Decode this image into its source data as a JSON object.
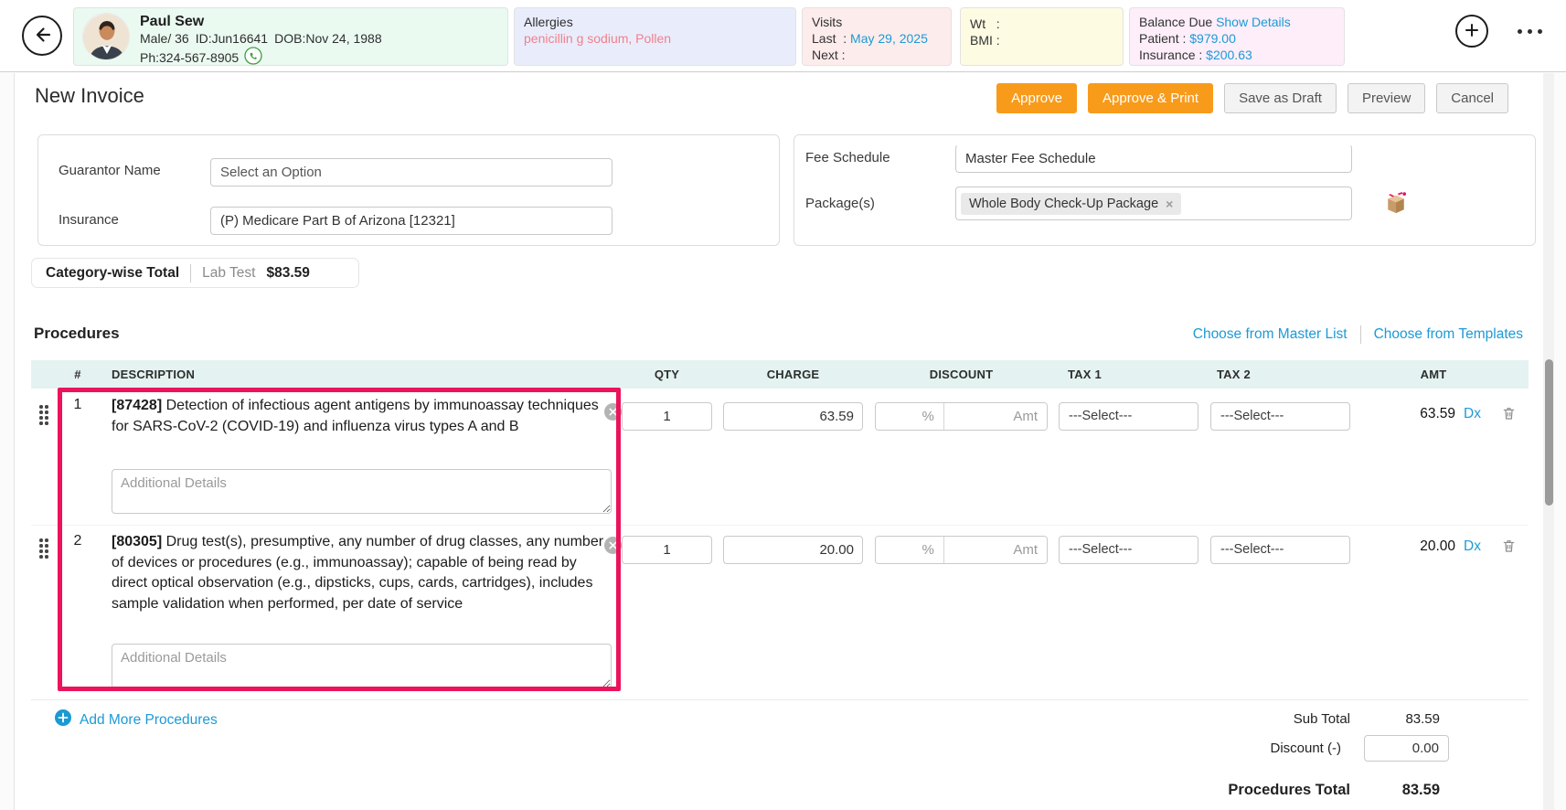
{
  "header": {
    "patient": {
      "name": "Paul Sew",
      "sex_age": "Male/ 36",
      "id": "ID:Jun16641",
      "dob": "DOB:Nov 24, 1988",
      "phone": "Ph:324-567-8905"
    },
    "allergies": {
      "title": "Allergies",
      "value": "penicillin g sodium, Pollen"
    },
    "visits": {
      "title": "Visits",
      "last_label": "Last  :",
      "last_value": "May 29, 2025",
      "next_label": "Next :"
    },
    "vitals": {
      "wt_label": "Wt   :",
      "bmi_label": "BMI :"
    },
    "balance": {
      "title": "Balance Due",
      "show_details": "Show Details",
      "patient_label": "Patient :",
      "patient_value": "$979.00",
      "insurance_label": "Insurance :",
      "insurance_value": "$200.63"
    }
  },
  "toolbar": {
    "title": "New Invoice",
    "approve": "Approve",
    "approve_print": "Approve & Print",
    "save_draft": "Save as Draft",
    "preview": "Preview",
    "cancel": "Cancel"
  },
  "form": {
    "guarantor_label": "Guarantor Name",
    "guarantor_placeholder": "Select an Option",
    "insurance_label": "Insurance",
    "insurance_value": "(P) Medicare Part B of Arizona [12321]",
    "fee_schedule_label": "Fee Schedule",
    "fee_schedule_value": "Master Fee Schedule",
    "packages_label": "Package(s)",
    "package_chip": "Whole Body Check-Up Package",
    "chip_remove": "×"
  },
  "category_total": {
    "label": "Category-wise Total",
    "category": "Lab Test",
    "amount": "$83.59"
  },
  "procedures": {
    "title": "Procedures",
    "choose_master": "Choose from Master List",
    "choose_templates": "Choose from Templates",
    "columns": [
      "#",
      "DESCRIPTION",
      "QTY",
      "CHARGE",
      "DISCOUNT",
      "TAX 1",
      "TAX 2",
      "AMT"
    ],
    "discount_pct_placeholder": "%",
    "discount_amt_placeholder": "Amt",
    "tax_placeholder": "---Select---",
    "additional_details_placeholder": "Additional Details",
    "dx_label": "Dx",
    "rows": [
      {
        "num": "1",
        "code": "[87428]",
        "description": "Detection of infectious agent antigens by immunoassay techniques for SARS-CoV-2 (COVID-19) and influenza virus types A and B",
        "qty": "1",
        "charge": "63.59",
        "amt": "63.59"
      },
      {
        "num": "2",
        "code": "[80305]",
        "description": "Drug test(s), presumptive, any number of drug classes, any number of devices or procedures (e.g., immunoassay); capable of being read by direct optical observation (e.g., dipsticks, cups, cards, cartridges), includes sample validation when performed, per date of service",
        "qty": "1",
        "charge": "20.00",
        "amt": "20.00"
      }
    ],
    "add_more": "Add More Procedures"
  },
  "totals": {
    "sub_total_label": "Sub Total",
    "sub_total": "83.59",
    "discount_label": "Discount (-)",
    "discount_value": "0.00",
    "procedures_total_label": "Procedures Total",
    "procedures_total": "83.59"
  },
  "icons": {
    "back": "arrow-left-circle",
    "phone": "phone-call",
    "plus": "plus-circle",
    "more": "ellipsis",
    "package": "open-package",
    "remove": "circle-x",
    "drag": "drag-handle",
    "trash": "trash-can",
    "add": "plus-circle-filled"
  },
  "colors": {
    "accent_orange": "#f89b1b",
    "link_blue": "#1c9ad6",
    "annotation_pink": "#ec135c",
    "table_header_bg": "#e4f3f1"
  }
}
